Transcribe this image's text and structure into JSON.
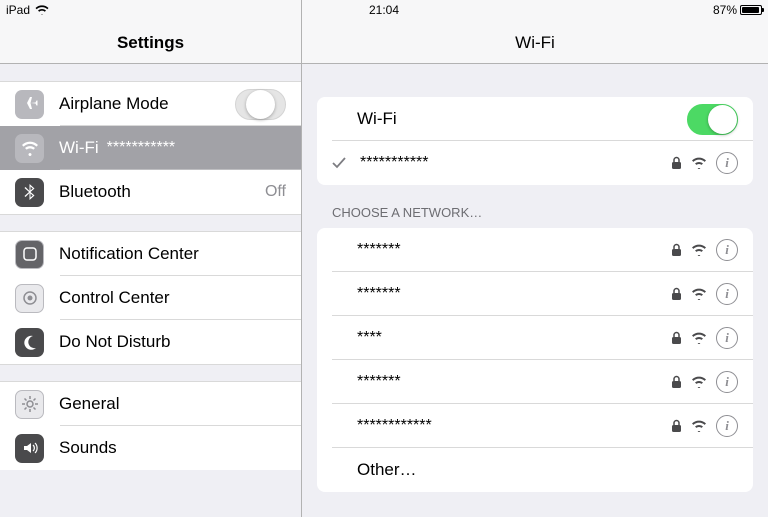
{
  "statusbar": {
    "device": "iPad",
    "time": "21:04",
    "battery_pct": "87%"
  },
  "left": {
    "title": "Settings",
    "items": {
      "airplane": {
        "label": "Airplane Mode",
        "on": false
      },
      "wifi": {
        "label": "Wi-Fi",
        "detail": "***********"
      },
      "bluetooth": {
        "label": "Bluetooth",
        "value": "Off"
      },
      "notif": {
        "label": "Notification Center"
      },
      "cc": {
        "label": "Control Center"
      },
      "dnd": {
        "label": "Do Not Disturb"
      },
      "general": {
        "label": "General"
      },
      "sounds": {
        "label": "Sounds"
      }
    }
  },
  "right": {
    "title": "Wi-Fi",
    "wifi_main_label": "Wi-Fi",
    "wifi_on": true,
    "connected": {
      "name": "***********",
      "secure": true
    },
    "choose_header": "Choose a Network…",
    "networks": [
      {
        "name": "*******",
        "secure": true
      },
      {
        "name": "*******",
        "secure": true
      },
      {
        "name": "****",
        "secure": true
      },
      {
        "name": "*******",
        "secure": true
      },
      {
        "name": "************",
        "secure": true
      }
    ],
    "other": "Other…"
  }
}
